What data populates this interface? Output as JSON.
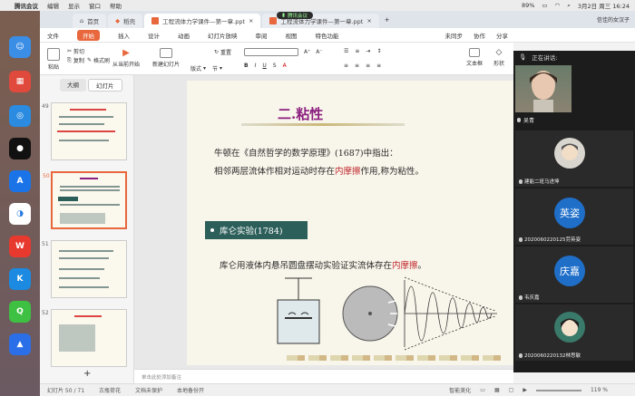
{
  "menubar": {
    "app": "腾讯会议",
    "items": [
      "编辑",
      "显示",
      "窗口",
      "帮助"
    ],
    "battery": "89%",
    "datetime": "3月2日 周三  16:24"
  },
  "tabs": {
    "home": "首页",
    "docer": "稻壳",
    "doc1": "工程流体力学课件—第一章.ppt",
    "doc2": "工程流体力学课件—第一章.ppt",
    "user": "信佳的女汉子"
  },
  "meeting_pill": "腾讯会议",
  "ribbon_menu": {
    "file": "文件",
    "start": "开始",
    "items": [
      "插入",
      "设计",
      "动画",
      "幻灯片放映",
      "审阅",
      "视图",
      "特色功能"
    ],
    "right": [
      "未同步",
      "协作",
      "分享"
    ]
  },
  "ribbon": {
    "paste": "粘贴",
    "cut": "剪切",
    "copy": "复制",
    "format": "格式刷",
    "from_current": "从当前开始",
    "new_slide": "新建幻灯片",
    "layout": "版式",
    "section": "节",
    "reset": "重置",
    "textbox": "文本框",
    "shape": "形状"
  },
  "panel": {
    "tab_outline": "大纲",
    "tab_slides": "幻灯片",
    "thumbs": [
      "49",
      "50",
      "51",
      "52"
    ],
    "add": "+"
  },
  "slide": {
    "title": "二.粘性",
    "line1": "牛顿在《自然哲学的数学原理》(1687)中指出：",
    "line2_a": "相邻两层流体作相对运动时存在",
    "line2_red": "内摩擦",
    "line2_b": "作用,称为粘性。",
    "box": "库仑实验(1784)",
    "line3_a": "库仑用液体内悬吊圆盘摆动实验证实流体存在",
    "line3_red": "内摩擦",
    "line3_b": "。"
  },
  "notes": "单击此处添加备注",
  "statusbar": {
    "slide_pos": "幻灯片 50 / 71",
    "theme": "古瓶荷花",
    "protect": "文档未保护",
    "backup": "本地备份开",
    "beautify": "智能美化",
    "zoom": "119 %"
  },
  "meeting": {
    "speaking_label": "正在讲话:",
    "speaker": "吴青",
    "participants": [
      {
        "name": "建能二班马进坤",
        "avatar": ""
      },
      {
        "name": "2020060220125劳英姿",
        "avatar": "英姿"
      },
      {
        "name": "韦庆嘉",
        "avatar": "庆嘉"
      },
      {
        "name": "2020060220132林思敏",
        "avatar": ""
      }
    ]
  },
  "colors": {
    "accent": "#e8673c",
    "slide_title": "#8b1e7f",
    "box": "#2d5f5a",
    "red_text": "#c0272d"
  }
}
